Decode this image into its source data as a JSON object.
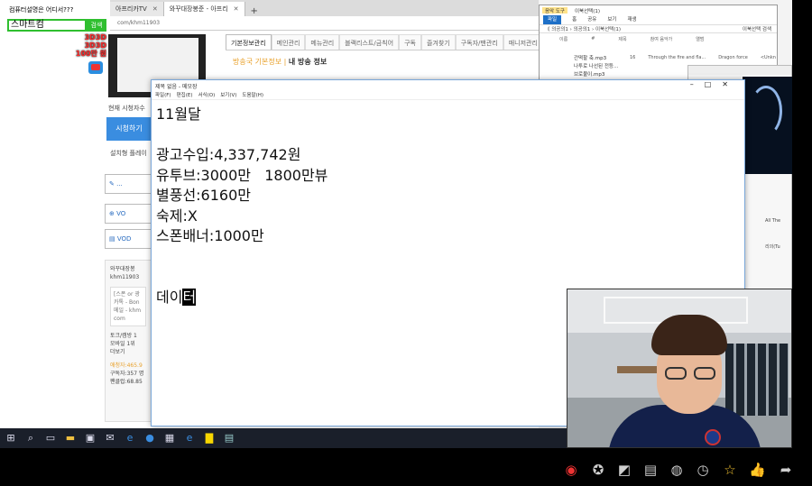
{
  "overlay": {
    "top_text": "컴퓨터설명은 어디서???",
    "search_text": "스마트컴",
    "search_button": "검색",
    "red_text": [
      "3D3D 3D3D",
      "100만 원"
    ]
  },
  "browser": {
    "tabs": [
      {
        "label": "아프리카TV",
        "active": false
      },
      {
        "label": "와꾸대장봉준 - 아프리",
        "active": true
      }
    ],
    "new_tab": "+",
    "url": "com/khm11903"
  },
  "streamer": {
    "current_viewers": "현재 시청자수",
    "watch_button": "시청하기",
    "install_text": "설치형 플레이",
    "side_buttons": [
      "✎ ...",
      "⊕ VO",
      "▤ VOD"
    ],
    "info_name": "와꾸대장봉",
    "info_id": "khm11903",
    "info_sub": "[스폰 or 광 카톡 - Bon 메일 - khm com",
    "toks": [
      "토크/캠방 1",
      "모바일 1위",
      "더보기"
    ],
    "stats": [
      "애청자:465.9",
      "구독자:357 명",
      "팬클럽:68.85"
    ]
  },
  "channel": {
    "tabs": [
      "기본정보관리",
      "메인관리",
      "메뉴관리",
      "블랙리스트/금칙어",
      "구독",
      "즐겨찾기",
      "구독자/팬관리",
      "매니저관리"
    ],
    "active_tab": 0,
    "broadcast_info_orange": "방송국 기본정보",
    "broadcast_info_dark": "내 방송 정보"
  },
  "notepad": {
    "title": "제목 없음 - 메모장",
    "menu": [
      "파일(F)",
      "편집(E)",
      "서식(O)",
      "보기(V)",
      "도움말(H)"
    ],
    "lines": [
      "11월달",
      "",
      "광고수입:4,337,742원",
      "유투브:3000만   1800만뷰",
      "별풍선:6160만",
      "숙제:X",
      "스폰배너:1000만",
      "",
      "",
      "데이"
    ],
    "cursor_char": "터"
  },
  "explorer": {
    "title_tag": "음악 도구",
    "title_text": "이북선택(1)",
    "ribbon": [
      "파일",
      "홈",
      "공유",
      "보기",
      "재생"
    ],
    "path": "《 의공의1 › 의공의1 › 이북선택(1)",
    "search": "이북선택 검색",
    "cols": [
      "이름",
      "#",
      "제목",
      "참여 음악가",
      "앨범"
    ],
    "row_sample": [
      "16",
      "Through the fire and fla...",
      "Dragon force",
      "<Unkn"
    ],
    "files": [
      "간떡할 축.mp3",
      "나투로 나선된 전등...",
      "브로불이.mp3"
    ]
  },
  "image_window": {
    "side_labels": [
      "All The",
      "리의(Tu"
    ]
  },
  "taskbar_icons": [
    "windows-icon",
    "search-icon",
    "task-view-icon",
    "explorer-icon",
    "store-icon",
    "mail-icon",
    "edge-icon",
    "app-icon",
    "photos-icon",
    "edge-icon-2",
    "kakao-icon",
    "notepad-icon"
  ],
  "bottom_icons": [
    "broadcast-icon",
    "star-medal-icon",
    "sticker-icon",
    "album-icon",
    "balloon-icon",
    "history-icon",
    "favorite-star-icon",
    "thumbs-up-icon",
    "share-icon"
  ],
  "colors": {
    "accent_green": "#2fbf2f",
    "accent_red": "#ff2a2a",
    "accent_blue": "#3a8de0",
    "orange": "#e8a02a"
  }
}
